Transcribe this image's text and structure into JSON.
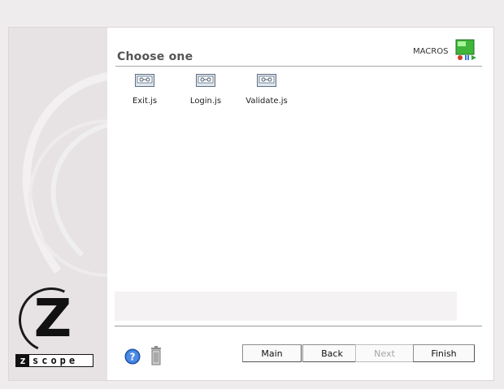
{
  "logo": {
    "letter": "Z",
    "word_block": "z",
    "word_rest": "scope"
  },
  "header": {
    "title": "Choose one",
    "macros_label": "MACROS",
    "macros_icon": "macros-icon"
  },
  "files": [
    {
      "name": "Exit.js",
      "icon": "cassette-icon"
    },
    {
      "name": "Login.js",
      "icon": "cassette-icon"
    },
    {
      "name": "Validate.js",
      "icon": "cassette-icon"
    }
  ],
  "status": {
    "text": ""
  },
  "footer": {
    "help_icon": "help-icon",
    "trash_icon": "trash-icon",
    "buttons": [
      {
        "label": "Main",
        "enabled": true
      },
      {
        "label": "Back",
        "enabled": true
      },
      {
        "label": "Next",
        "enabled": false
      },
      {
        "label": "Finish",
        "enabled": true
      }
    ]
  }
}
